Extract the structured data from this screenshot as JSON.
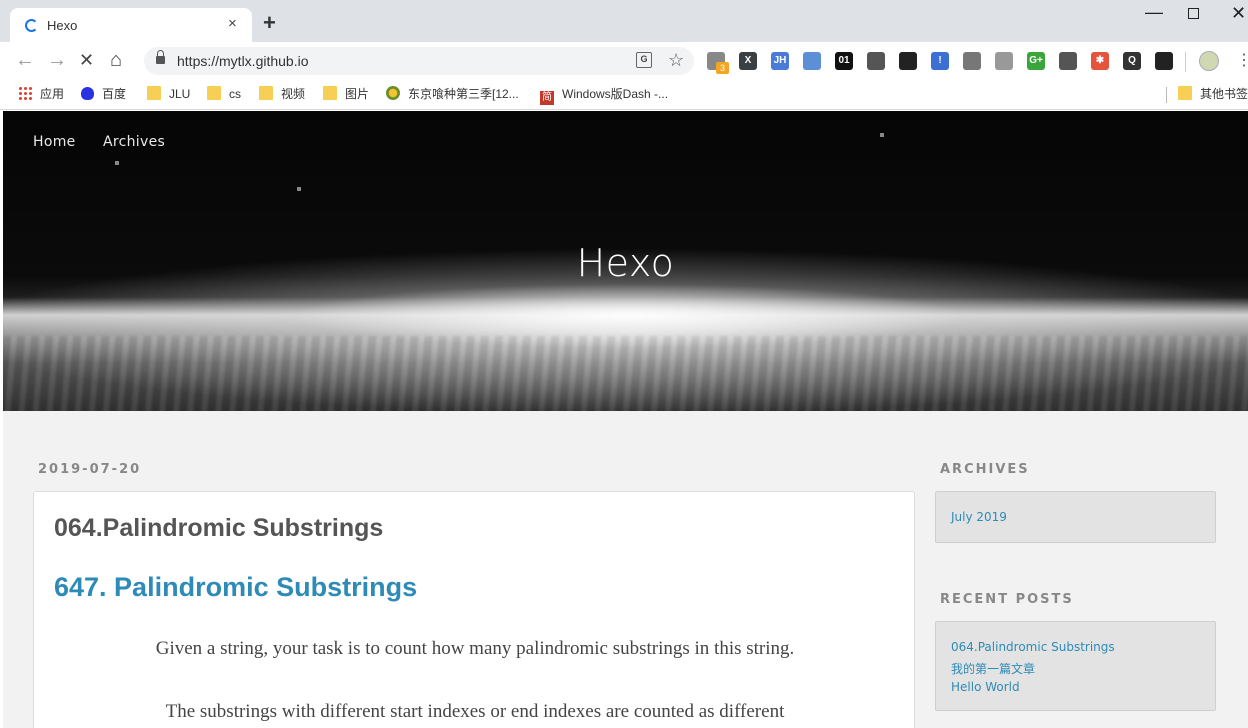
{
  "browser": {
    "tab_title": "Hexo",
    "tab_close": "×",
    "new_tab": "+",
    "url": "https://mytlx.github.io",
    "window_controls": {
      "minimize": "—",
      "close": "✕"
    },
    "extensions_badge": "3",
    "extensions": [
      {
        "name": "octotree-icon",
        "text": "",
        "color": "#888888"
      },
      {
        "name": "x-icon",
        "text": "X",
        "color": "#3a3f44"
      },
      {
        "name": "jh-icon",
        "text": "JH",
        "color": "#4a7bd8"
      },
      {
        "name": "opera-icon",
        "text": "",
        "color": "#5b8fd6"
      },
      {
        "name": "binary-icon",
        "text": "01",
        "color": "#111111"
      },
      {
        "name": "eye-icon",
        "text": "",
        "color": "#555555"
      },
      {
        "name": "gamepad-icon",
        "text": "",
        "color": "#222222"
      },
      {
        "name": "mail-alert-icon",
        "text": "!",
        "color": "#3b6fd4"
      },
      {
        "name": "terminal-icon",
        "text": "",
        "color": "#777777"
      },
      {
        "name": "tree-icon",
        "text": "",
        "color": "#999999"
      },
      {
        "name": "gplus-icon",
        "text": "G+",
        "color": "#3aa53a"
      },
      {
        "name": "pin-icon",
        "text": "",
        "color": "#555555"
      },
      {
        "name": "asterisk-icon",
        "text": "✱",
        "color": "#e5533d"
      },
      {
        "name": "q-icon",
        "text": "Q",
        "color": "#333333"
      },
      {
        "name": "spy-icon",
        "text": "",
        "color": "#222222"
      }
    ]
  },
  "bookmarks": [
    {
      "label": "应用",
      "icon": "apps-icon"
    },
    {
      "label": "百度",
      "icon": "baidu-icon"
    },
    {
      "label": "JLU",
      "icon": "folder-icon"
    },
    {
      "label": "cs",
      "icon": "folder-icon"
    },
    {
      "label": "视频",
      "icon": "folder-icon"
    },
    {
      "label": "图片",
      "icon": "folder-icon"
    },
    {
      "label": "东京喰种第三季[12...",
      "icon": "site-icon"
    },
    {
      "label": "Windows版Dash -...",
      "icon": "jian-icon"
    },
    {
      "label": "其他书签",
      "icon": "folder-icon"
    }
  ],
  "site": {
    "nav": [
      "Home",
      "Archives"
    ],
    "title": "Hexo"
  },
  "post": {
    "date": "2019-07-20",
    "title": "064.Palindromic Substrings",
    "heading": "647. Palindromic Substrings",
    "paragraphs": [
      "Given a string, your task is to count how many palindromic substrings in this string.",
      "The substrings with different start indexes or end indexes are counted as different"
    ]
  },
  "sidebar": {
    "archives_heading": "ARCHIVES",
    "archives": [
      "July 2019"
    ],
    "recent_heading": "RECENT POSTS",
    "recent": [
      "064.Palindromic Substrings",
      "我的第一篇文章",
      "Hello World"
    ]
  },
  "colors": {
    "link": "#2e8bb7",
    "page_bg": "#f2f2f2",
    "sidebar_box": "#e3e3e3"
  }
}
